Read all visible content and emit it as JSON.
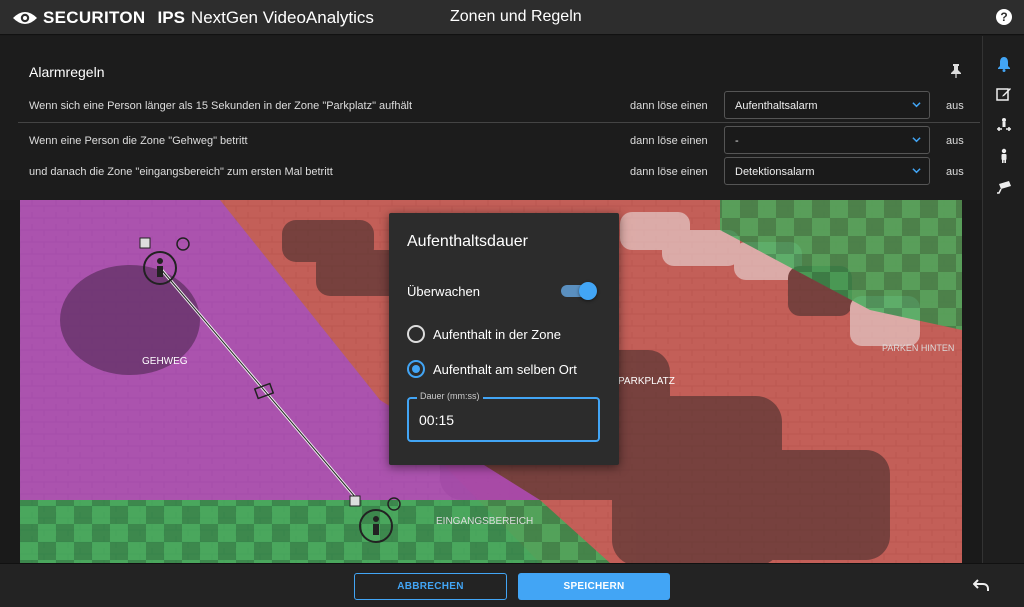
{
  "header": {
    "brand": "SECURITON",
    "product_bold": "IPS",
    "product_name": "NextGen VideoAnalytics",
    "page_title": "Zonen und Regeln",
    "help_label": "?"
  },
  "rules": {
    "title": "Alarmregeln",
    "items": [
      {
        "text": "Wenn sich eine Person länger als 15 Sekunden in der Zone \"Parkplatz\" aufhält",
        "then": "dann löse einen",
        "select": "Aufenthaltsalarm",
        "suffix": "aus"
      },
      {
        "text": "Wenn eine Person die Zone \"Gehweg\" betritt",
        "then": "dann löse einen",
        "select": "-",
        "suffix": "aus"
      },
      {
        "text": "und danach die Zone \"eingangsbereich\" zum ersten Mal betritt",
        "then": "dann löse einen",
        "select": "Detektionsalarm",
        "suffix": "aus"
      }
    ]
  },
  "camera": {
    "zones": [
      "GEHWEG",
      "PARKPLATZ",
      "EINGANGSBEREICH",
      "PARKEN HINTEN"
    ],
    "colors": {
      "gehweg": "#b04bb8",
      "parkplatz": "#d9534f",
      "eingang": "#3fae5a"
    }
  },
  "dialog": {
    "title": "Aufenthaltsdauer",
    "watch_label": "Überwachen",
    "watch_on": true,
    "options": [
      "Aufenthalt in der Zone",
      "Aufenthalt am selben Ort"
    ],
    "selected_option": 1,
    "duration_label": "Dauer (mm:ss)",
    "duration_value": "00:15"
  },
  "footer": {
    "cancel_label": "ABBRECHEN",
    "save_label": "SPEICHERN"
  },
  "sidebar": {
    "icons": [
      "bell-icon",
      "edit-icon",
      "people-zone-icon",
      "person-icon",
      "camera-icon"
    ]
  },
  "colors": {
    "accent": "#42a5f5",
    "header_bg": "#2d2d2d",
    "panel_bg": "#1c1c1c"
  }
}
